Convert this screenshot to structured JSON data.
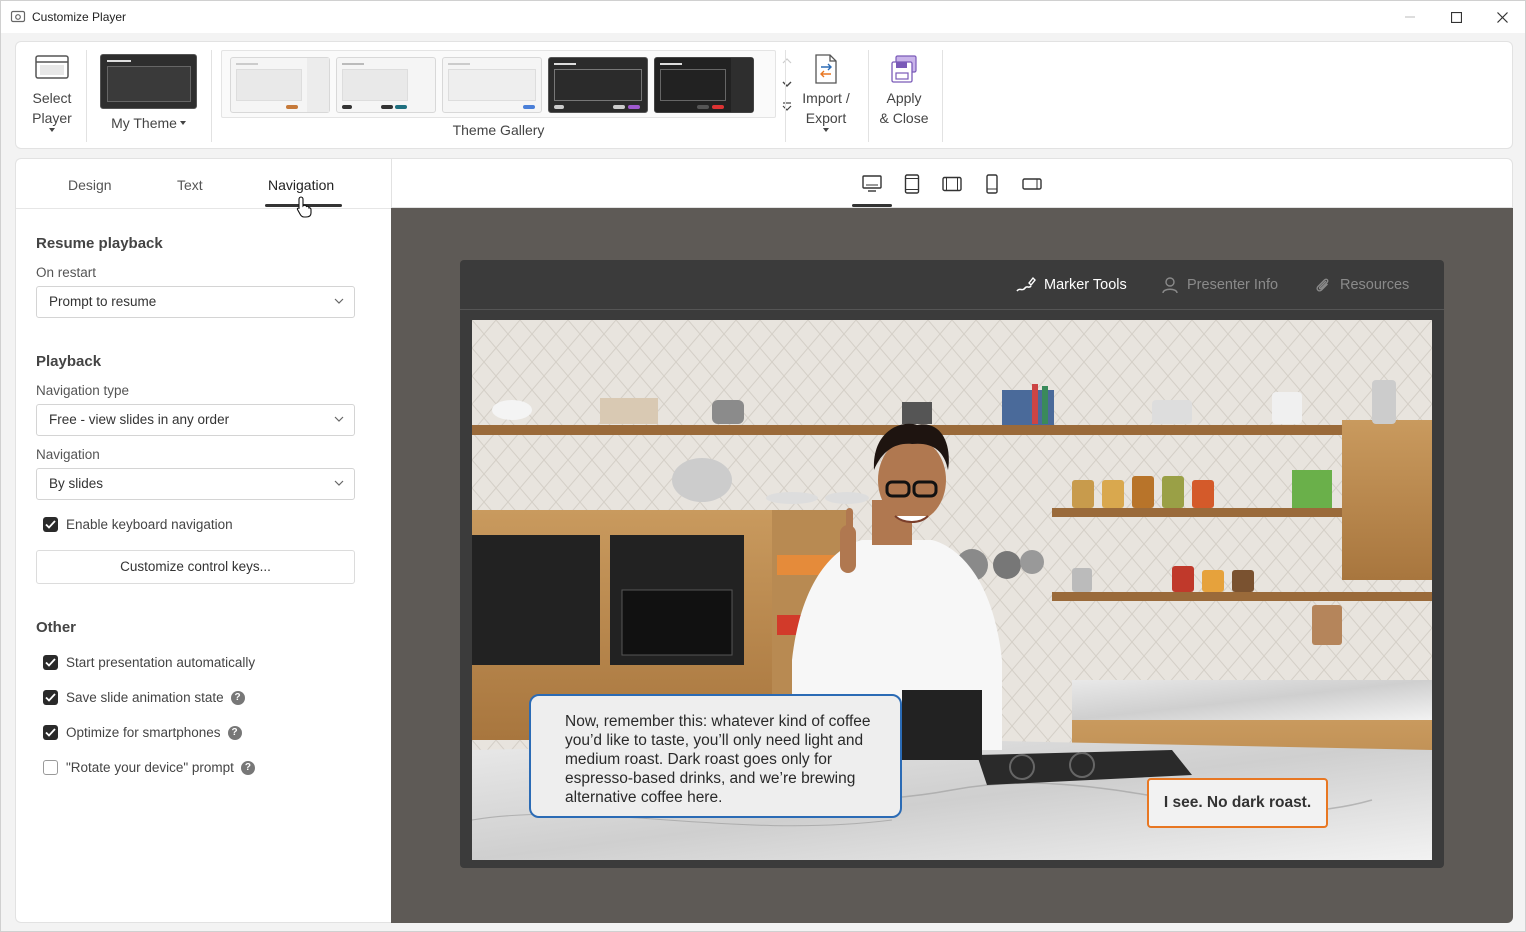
{
  "window": {
    "title": "Customize Player",
    "controls": {
      "minimize": "minimize-icon",
      "maximize": "maximize-icon",
      "close": "close-icon"
    }
  },
  "ribbon": {
    "select_player": {
      "line1": "Select",
      "line2": "Player",
      "icon": "player-window-icon"
    },
    "my_theme": {
      "label": "My Theme"
    },
    "gallery": {
      "label": "Theme Gallery",
      "themes": [
        "Light",
        "Light Teal",
        "Light Blue",
        "Dark Purple",
        "Dark Red"
      ]
    },
    "import_export": {
      "line1": "Import /",
      "line2": "Export",
      "icon": "import-export-icon"
    },
    "apply_close": {
      "line1": "Apply",
      "line2": "& Close",
      "icon": "apply-close-icon"
    }
  },
  "left_panel": {
    "tabs": [
      "Design",
      "Text",
      "Navigation"
    ],
    "active_tab": "Navigation",
    "resume": {
      "heading": "Resume playback",
      "on_restart_label": "On restart",
      "on_restart_value": "Prompt to resume"
    },
    "playback": {
      "heading": "Playback",
      "nav_type_label": "Navigation type",
      "nav_type_value": "Free - view slides in any order",
      "navigation_label": "Navigation",
      "navigation_value": "By slides",
      "keyboard_nav": {
        "label": "Enable keyboard navigation",
        "checked": true
      },
      "customize_keys": "Customize control keys..."
    },
    "other": {
      "heading": "Other",
      "start_auto": {
        "label": "Start presentation automatically",
        "checked": true
      },
      "save_anim": {
        "label": "Save slide animation state",
        "checked": true
      },
      "optimize_phones": {
        "label": "Optimize for smartphones",
        "checked": true
      },
      "rotate_prompt": {
        "label": "\"Rotate your device\" prompt",
        "checked": false
      },
      "help": "?"
    }
  },
  "preview": {
    "devices": [
      "desktop-icon",
      "tablet-portrait-icon",
      "tablet-landscape-icon",
      "phone-portrait-icon",
      "phone-landscape-icon"
    ],
    "active_device": "desktop-icon",
    "player_tabs": [
      {
        "label": "Marker Tools",
        "icon": "marker-icon",
        "active": true
      },
      {
        "label": "Presenter Info",
        "icon": "user-icon",
        "active": false
      },
      {
        "label": "Resources",
        "icon": "paperclip-icon",
        "active": false
      }
    ],
    "slide": {
      "speech": "Now, remember this: whatever  kind of coffee you’d like to taste, you’ll only need light and medium roast. Dark roast goes only for espresso-based drinks, and we’re brewing alternative  coffee here.",
      "answer": "I see. No dark roast."
    }
  },
  "colors": {
    "accent_blue": "#2b6bb5",
    "accent_orange": "#e87722",
    "stage_bg": "#5e5a56",
    "player_bg": "#3b3b3b"
  }
}
